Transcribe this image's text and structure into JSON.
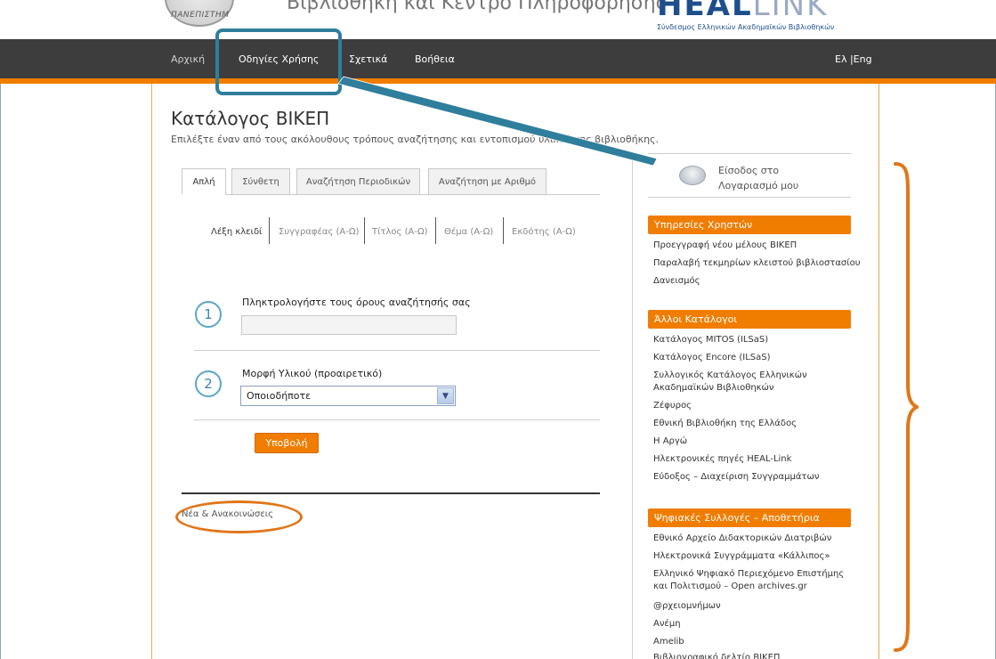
{
  "header": {
    "seal_text": "ΠΑΝΕΠΙΣΤΗΜ",
    "site_title": "Βιβλιοθήκη και Κέντρο Πληροφόρησης",
    "heal_logo_main": "HEAL",
    "heal_logo_link": "LINK",
    "heal_subtitle": "Σύνδεσμος Ελληνικών Ακαδημαϊκών Βιβλιοθηκών"
  },
  "nav": {
    "home": "Αρχική",
    "guide": "Οδηγίες Χρήσης",
    "about": "Σχετικά",
    "help": "Βοήθεια",
    "lang": "Ελ |Eng"
  },
  "main": {
    "title": "Κατάλογος ΒΙΚΕΠ",
    "subtitle": "Επιλέξτε έναν από τους ακόλουθους τρόπους αναζήτησης και εντοπισμού υλικού της βιβλιοθήκης.",
    "tabs": [
      "Απλή",
      "Σύνθετη",
      "Αναζήτηση Περιοδικών",
      "Αναζήτηση με Αριθμό"
    ],
    "subtabs": [
      "Λέξη κλειδί",
      "Συγγραφέας (Α-Ω)",
      "Τίτλος (Α-Ω)",
      "Θέμα (Α-Ω)",
      "Εκδότης (Α-Ω)"
    ],
    "step1_num": "1",
    "step1_label": "Πληκτρολογήστε τους όρους αναζήτησής σας",
    "search_value": "",
    "step2_num": "2",
    "step2_label": "Μορφή Υλικού (προαιρετικό)",
    "material_selected": "Οποιοδήποτε",
    "submit": "Υποβολή",
    "news_title": "Νέα & Ανακοινώσεις"
  },
  "sidebar": {
    "login": "Είσοδος στο Λογαριασμό μου",
    "sections": [
      {
        "title": "Υπηρεσίες Χρηστών",
        "links": [
          "Προεγγραφή νέου μέλους ΒΙΚΕΠ",
          "Παραλαβή τεκμηρίων κλειστού βιβλιοστασίου",
          "Δανεισμός"
        ]
      },
      {
        "title": "Άλλοι Κατάλογοι",
        "links": [
          "Κατάλογος MITOS (ILSaS)",
          "Κατάλογος Encore (ILSaS)",
          "Συλλογικός Κατάλογος Ελληνικών",
          "Ακαδημαϊκών Βιβλιοθηκών",
          "Ζέφυρος",
          "Εθνική Βιβλιοθήκη της Ελλάδος",
          "Η Αργώ",
          "Ηλεκτρονικές πηγές HEAL-Link",
          "Εύδοξος – Διαχείριση Συγγραμμάτων"
        ]
      },
      {
        "title": "Ψηφιακές Συλλογές – Αποθετήρια",
        "links": [
          "Εθνικό Αρχείο Διδακτορικών Διατριβών",
          "Ηλεκτρονικά Συγγράμματα «Κάλλιπος»",
          "Ελληνικό Ψηφιακό Περιεχόμενο Επιστήμης",
          "και Πολιτισμού – Open archives.gr",
          "@ρχειομνήμων",
          "Ανέμη",
          "Amelib",
          "Βιβλιογραφικό δελτίο ΒΙΚΕΠ"
        ]
      }
    ]
  },
  "colors": {
    "accent": "#f07d00",
    "nav_bg": "#3d3d3d",
    "annotation_blue": "#2f7e9c",
    "annotation_orange": "#e07619"
  }
}
